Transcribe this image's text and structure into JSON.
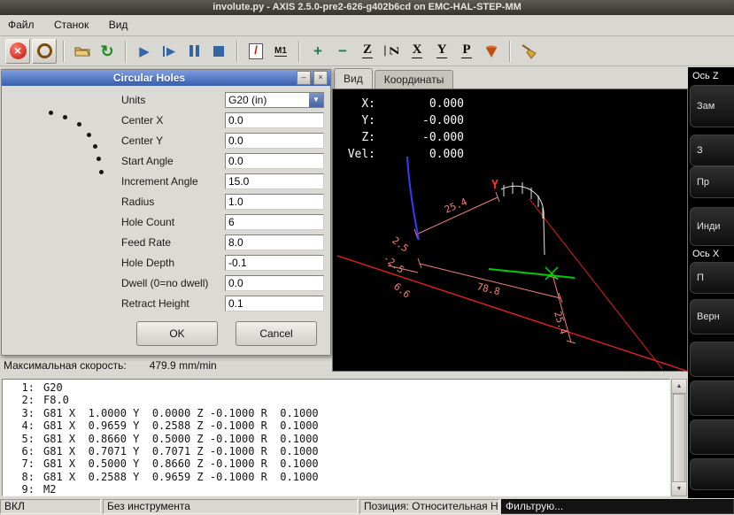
{
  "window": {
    "title": "involute.py - AXIS 2.5.0-pre2-626-g402b6cd on EMC-HAL-STEP-MM"
  },
  "menu": {
    "items": [
      "Файл",
      "Станок",
      "Вид"
    ]
  },
  "glyphs": {
    "estop": "×",
    "reload": "↻",
    "run": "▶",
    "step_arrow": "▶",
    "slash": "/",
    "m1": "M1",
    "plus": "+",
    "minus": "−",
    "view_z": "Z",
    "view_z_rotated": "Z",
    "view_x": "X",
    "view_y": "Y",
    "view_p": "P",
    "combo_arrow": "▼",
    "scroll_up": "▲",
    "scroll_down": "▼",
    "dlg_min": "–",
    "dlg_close": "×"
  },
  "tabs": {
    "view": "Вид",
    "coords": "Координаты"
  },
  "dro": {
    "rows": [
      {
        "label": "X:",
        "value": "0.000"
      },
      {
        "label": "Y:",
        "value": "-0.000"
      },
      {
        "label": "Z:",
        "value": "-0.000"
      },
      {
        "label": "Vel:",
        "value": "0.000"
      }
    ]
  },
  "preview": {
    "dims": {
      "top": "25.4",
      "bottom": "78.8",
      "left": "6.6",
      "small_pos": "2.5",
      "small_neg": "-2.5",
      "right": "25.4",
      "y_axis": "Y"
    }
  },
  "dialog": {
    "title": "Circular Holes",
    "fields": [
      {
        "label": "Units",
        "value": "G20 (in)"
      },
      {
        "label": "Center X",
        "value": "0.0"
      },
      {
        "label": "Center Y",
        "value": "0.0"
      },
      {
        "label": "Start Angle",
        "value": "0.0"
      },
      {
        "label": "Increment Angle",
        "value": "15.0"
      },
      {
        "label": "Radius",
        "value": "1.0"
      },
      {
        "label": "Hole Count",
        "value": "6"
      },
      {
        "label": "Feed Rate",
        "value": "8.0"
      },
      {
        "label": "Hole Depth",
        "value": "-0.1"
      },
      {
        "label": "Dwell (0=no dwell)",
        "value": "0.0"
      },
      {
        "label": "Retract Height",
        "value": "0.1"
      }
    ],
    "ok": "OK",
    "cancel": "Cancel",
    "preview_dots": [
      [
        53,
        28
      ],
      [
        69,
        33
      ],
      [
        85,
        41
      ],
      [
        96,
        53
      ],
      [
        103,
        66
      ],
      [
        107,
        80
      ],
      [
        110,
        95
      ]
    ]
  },
  "maxvel": {
    "label": "Максимальная скорость:",
    "value": "479.9 mm/min"
  },
  "gcode": {
    "lines": [
      {
        "n": "1:",
        "text": "G20"
      },
      {
        "n": "2:",
        "text": "F8.0"
      },
      {
        "n": "3:",
        "text": "G81 X  1.0000 Y  0.0000 Z -0.1000 R  0.1000"
      },
      {
        "n": "4:",
        "text": "G81 X  0.9659 Y  0.2588 Z -0.1000 R  0.1000"
      },
      {
        "n": "5:",
        "text": "G81 X  0.8660 Y  0.5000 Z -0.1000 R  0.1000"
      },
      {
        "n": "6:",
        "text": "G81 X  0.7071 Y  0.7071 Z -0.1000 R  0.1000"
      },
      {
        "n": "7:",
        "text": "G81 X  0.5000 Y  0.8660 Z -0.1000 R  0.1000"
      },
      {
        "n": "8:",
        "text": "G81 X  0.2588 Y  0.9659 Z -0.1000 R  0.1000"
      },
      {
        "n": "9:",
        "text": "M2"
      }
    ]
  },
  "right_panel": {
    "axis_z": "Ось Z",
    "zam": "Зам",
    "z": "З",
    "pr": "Пр",
    "indi": "Инди",
    "axis_x": "Ось X",
    "p": "П",
    "vern": "Верн"
  },
  "statusbar": {
    "segments": [
      "ВКЛ",
      "Без инструмента",
      "Позиция: Относительная Насто",
      "Фильтрую..."
    ]
  }
}
